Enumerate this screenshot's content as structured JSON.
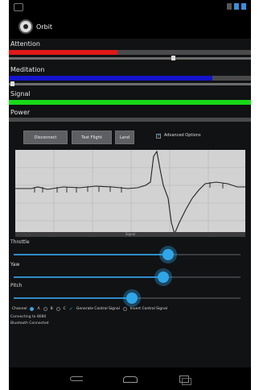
{
  "app": {
    "title": "Orbit"
  },
  "meters": [
    {
      "label": "Attention",
      "value": 0.45,
      "color": "#e01818"
    },
    {
      "label": "Meditation",
      "value": 0.84,
      "color": "#1414cc"
    },
    {
      "label": "Signal",
      "value": 1.0,
      "color": "#18d818"
    },
    {
      "label": "Power",
      "value": 0.0,
      "color": "#888888"
    }
  ],
  "toolbar": {
    "disconnect": "Disconnect",
    "test_flight": "Test Flight",
    "land": "Land",
    "advanced_options": "Advanced Options"
  },
  "chart_footer": "Signal",
  "sliders": [
    {
      "label": "Throttle",
      "value": 0.68
    },
    {
      "label": "Yaw",
      "value": 0.66
    },
    {
      "label": "Pitch",
      "value": 0.52
    }
  ],
  "options": {
    "channel_label": "Channel",
    "channels": [
      "A",
      "B",
      "C"
    ],
    "selected_channel": "A",
    "generate_label": "Generate Control Signal",
    "invert_label": "Invert Control Signal"
  },
  "status_lines": [
    "Connecting to 8080",
    "Bluetooth Connected"
  ],
  "colors": {
    "accent": "#2fa6e8",
    "background": "#111214"
  }
}
